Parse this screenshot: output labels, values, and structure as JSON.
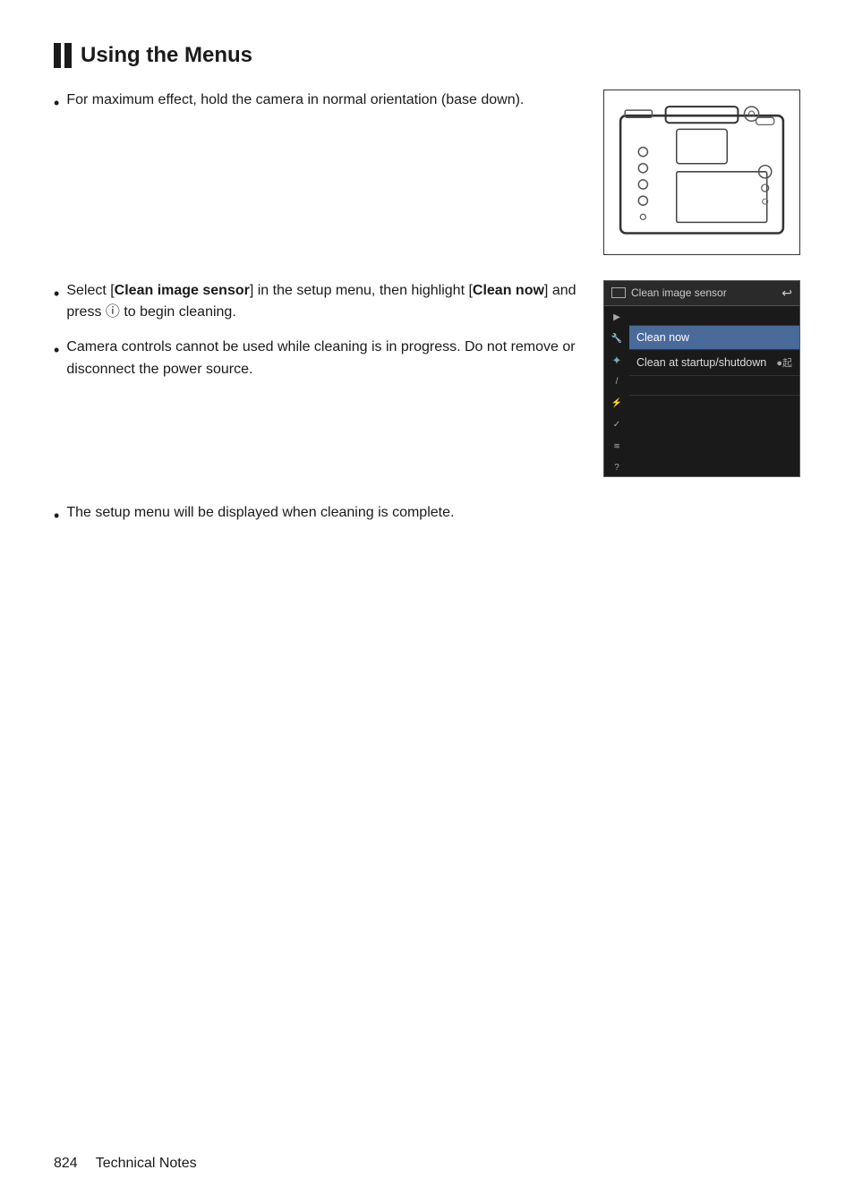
{
  "page": {
    "title": "Using the Menus",
    "title_bars": 2,
    "top_bullet": "For maximum effect, hold the camera in normal orientation (base down).",
    "bullet1_prefix": "Select [",
    "bullet1_bold1": "Clean image sensor",
    "bullet1_mid": "] in the setup menu, then highlight [",
    "bullet1_bold2": "Clean now",
    "bullet1_end": "] and press Ⓢ to begin cleaning.",
    "bullet2": "Camera controls cannot be used while cleaning is in progress. Do not remove or disconnect the power source.",
    "bullet3": "The setup menu will be displayed when cleaning is complete.",
    "menu": {
      "header_text": "Clean image sensor",
      "back_icon": "↺",
      "item1": "Clean now",
      "item2_text": "Clean at startup/shutdown",
      "item2_icon": "●起"
    },
    "footer": {
      "page_number": "824",
      "section": "Technical Notes"
    }
  }
}
